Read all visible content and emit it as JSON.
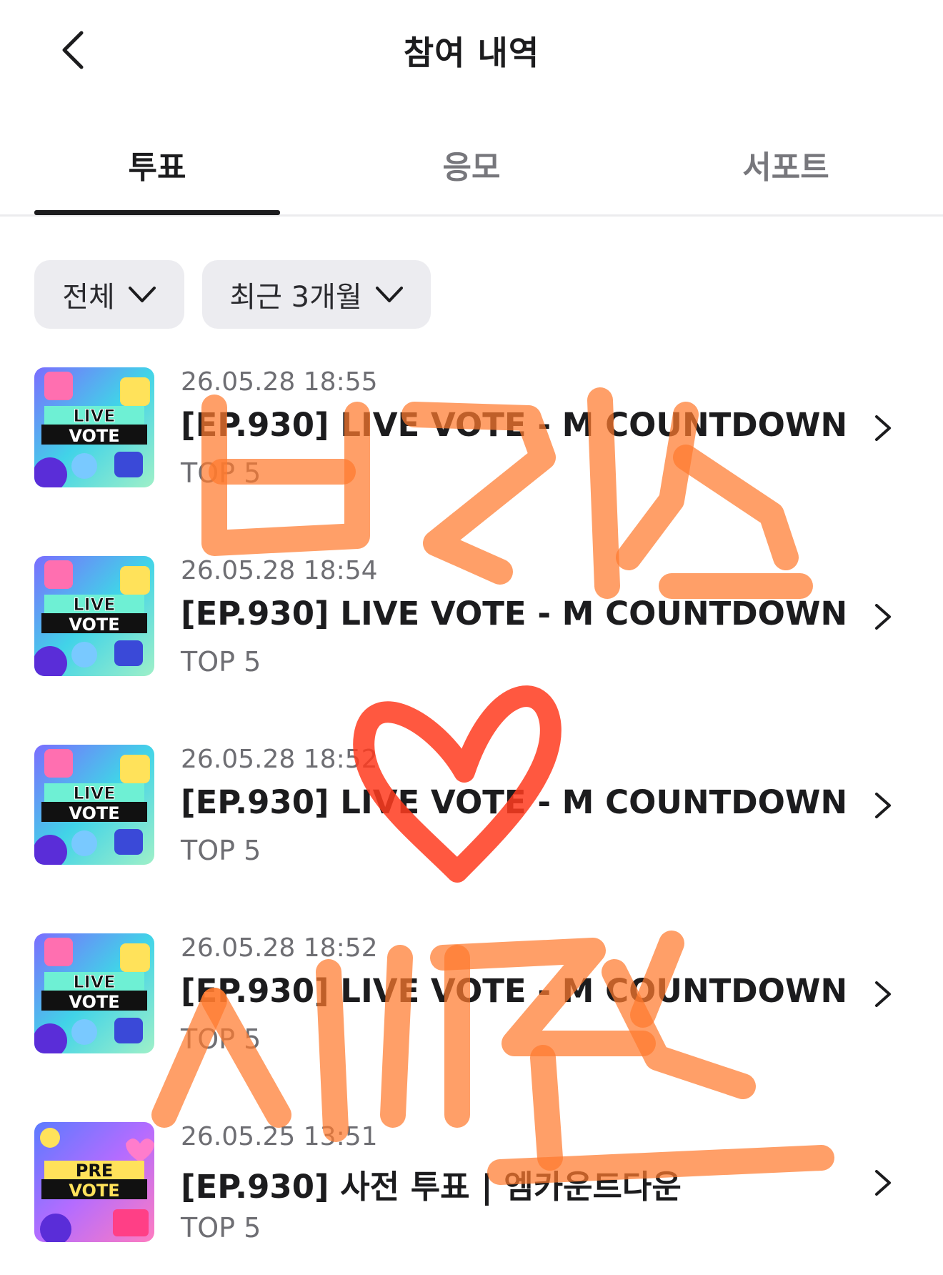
{
  "header": {
    "title": "참여 내역",
    "back_icon": "chevron-left-icon"
  },
  "tabs": [
    {
      "label": "투표",
      "active": true
    },
    {
      "label": "응모",
      "active": false
    },
    {
      "label": "서포트",
      "active": false
    }
  ],
  "filters": {
    "category": "전체",
    "period": "최근 3개월",
    "dropdown_icon": "chevron-down-icon"
  },
  "items": [
    {
      "time": "26.05.28 18:55",
      "title": "[EP.930] LIVE VOTE - M COUNTDOWN",
      "sub": "TOP 5",
      "thumb": {
        "line1": "LIVE",
        "line2": "VOTE"
      }
    },
    {
      "time": "26.05.28 18:54",
      "title": "[EP.930] LIVE VOTE - M COUNTDOWN",
      "sub": "TOP 5",
      "thumb": {
        "line1": "LIVE",
        "line2": "VOTE"
      }
    },
    {
      "time": "26.05.28 18:52",
      "title": "[EP.930] LIVE VOTE - M COUNTDOWN",
      "sub": "TOP 5",
      "thumb": {
        "line1": "LIVE",
        "line2": "VOTE"
      }
    },
    {
      "time": "26.05.28 18:52",
      "title": "[EP.930] LIVE VOTE - M COUNTDOWN",
      "sub": "TOP 5",
      "thumb": {
        "line1": "LIVE",
        "line2": "VOTE"
      }
    },
    {
      "time": "26.05.25 13:51",
      "title": "[EP.930] 사전 투표 | 엠카운트다운",
      "sub": "TOP 5",
      "thumb": {
        "line1": "PRE",
        "line2": "VOTE"
      }
    }
  ],
  "colors": {
    "accent_text": "#1c1c1e",
    "muted_text": "#6e6e73",
    "filter_bg": "#ececf0",
    "annotation_orange": "#ff7a2e",
    "annotation_red": "#ff3b1f"
  }
}
